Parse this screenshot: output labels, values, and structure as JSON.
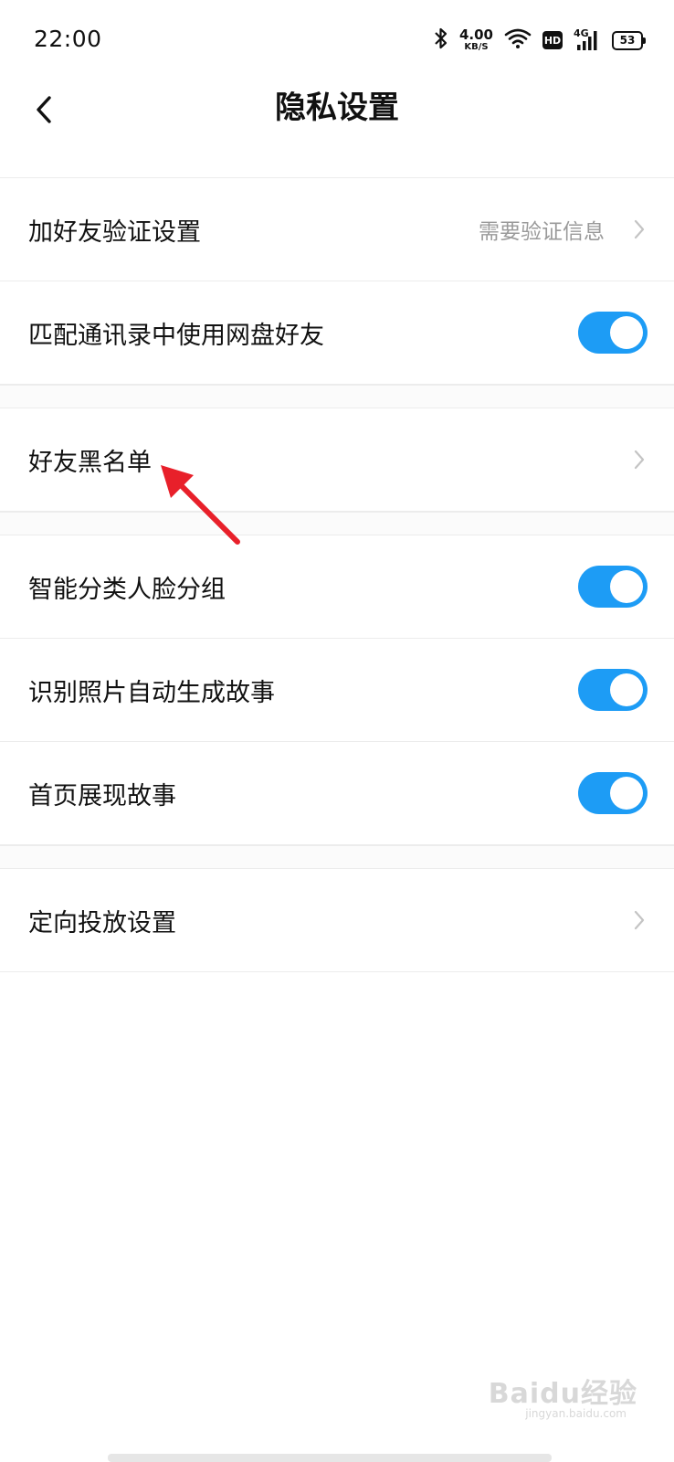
{
  "status_bar": {
    "time": "22:00",
    "net_speed_value": "4.00",
    "net_speed_unit": "KB/S",
    "hd_label": "HD",
    "network_label": "4G",
    "battery": "53"
  },
  "header": {
    "title": "隐私设置"
  },
  "settings": {
    "group1": [
      {
        "label": "加好友验证设置",
        "value": "需要验证信息"
      },
      {
        "label": "匹配通讯录中使用网盘好友",
        "on": true
      }
    ],
    "group2": [
      {
        "label": "好友黑名单"
      }
    ],
    "group3": [
      {
        "label": "智能分类人脸分组",
        "on": true
      },
      {
        "label": "识别照片自动生成故事",
        "on": true
      },
      {
        "label": "首页展现故事",
        "on": true
      }
    ],
    "group4": [
      {
        "label": "定向投放设置"
      }
    ]
  },
  "watermark": {
    "brand": "Baidu经验",
    "url": "jingyan.baidu.com"
  },
  "colors": {
    "accent": "#1d9cf5",
    "annotation": "#e8202a"
  }
}
